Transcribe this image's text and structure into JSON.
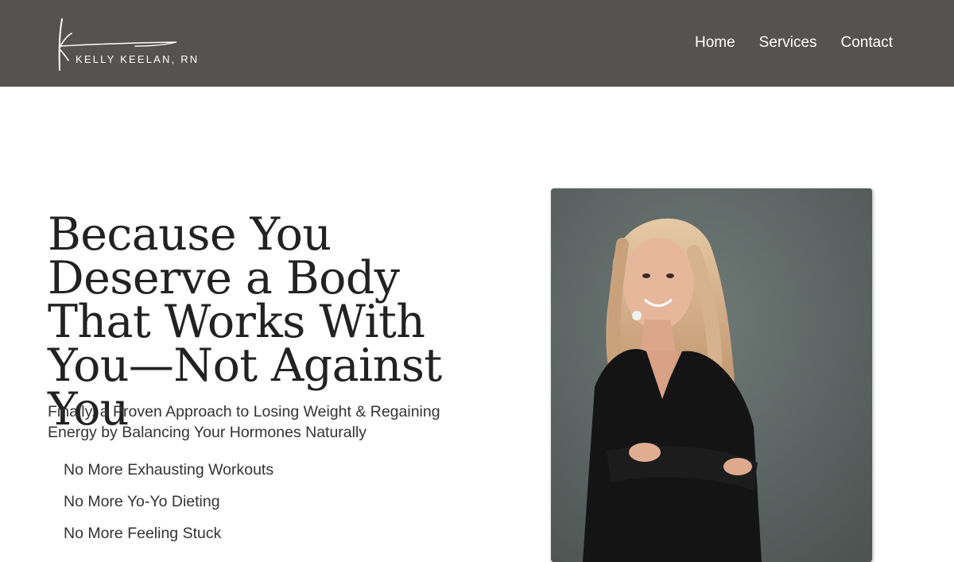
{
  "header": {
    "brand": "KELLY KEELAN, RN",
    "nav": [
      {
        "label": "Home"
      },
      {
        "label": "Services"
      },
      {
        "label": "Contact"
      }
    ],
    "background_color": "#545351"
  },
  "hero": {
    "title": "Because You Deserve a Body That Works With You—Not Against You",
    "subtitle": "Finally, a Proven Approach to Losing Weight & Regaining Energy by Balancing Your Hormones Naturally",
    "bullets": [
      "No More Exhausting Workouts",
      "No More Yo-Yo Dieting",
      "No More Feeling Stuck"
    ],
    "photo_icon": "portrait-photo"
  }
}
